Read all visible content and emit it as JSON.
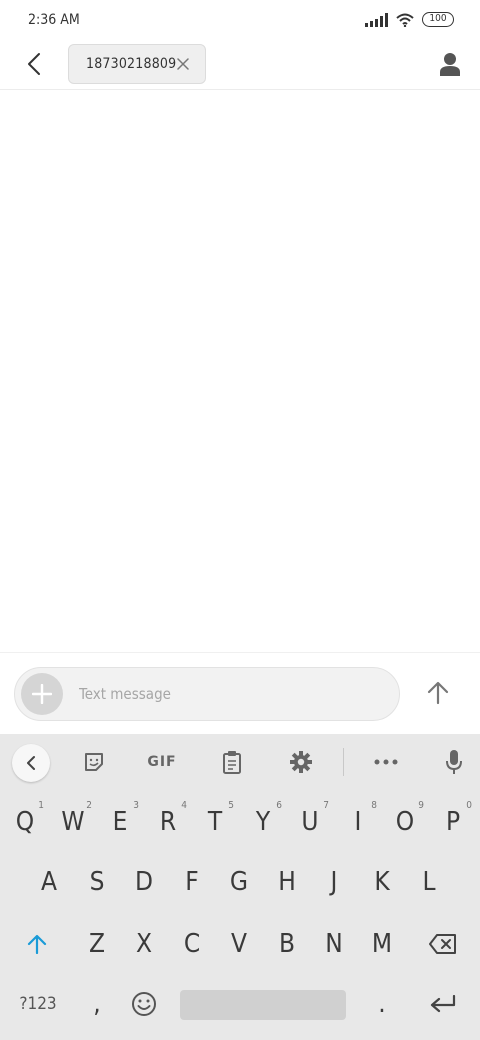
{
  "status_bar": {
    "time": "2:36 AM",
    "battery": "100",
    "icons": [
      "signal-icon",
      "wifi-icon",
      "battery-icon"
    ]
  },
  "header": {
    "back_icon": "chevron-left-icon",
    "recipient": "18730218809",
    "chip_close_icon": "close-icon",
    "contact_icon": "person-icon"
  },
  "compose": {
    "attach_icon": "plus-icon",
    "placeholder": "Text message",
    "value": "",
    "send_icon": "arrow-up-icon"
  },
  "keyboard": {
    "toolbar": [
      "chevron-left-icon",
      "sticker-icon",
      "GIF",
      "clipboard-icon",
      "gear-icon",
      "more-icon",
      "mic-icon"
    ],
    "gif_label": "GIF",
    "row1": [
      {
        "label": "Q",
        "hint": "1"
      },
      {
        "label": "W",
        "hint": "2"
      },
      {
        "label": "E",
        "hint": "3"
      },
      {
        "label": "R",
        "hint": "4"
      },
      {
        "label": "T",
        "hint": "5"
      },
      {
        "label": "Y",
        "hint": "6"
      },
      {
        "label": "U",
        "hint": "7"
      },
      {
        "label": "I",
        "hint": "8"
      },
      {
        "label": "O",
        "hint": "9"
      },
      {
        "label": "P",
        "hint": "0"
      }
    ],
    "row2": [
      "A",
      "S",
      "D",
      "F",
      "G",
      "H",
      "J",
      "K",
      "L"
    ],
    "row3": [
      "Z",
      "X",
      "C",
      "V",
      "B",
      "N",
      "M"
    ],
    "row4": {
      "symbols": "?123",
      "comma": ",",
      "period": ".",
      "enter_icon": "enter-icon",
      "emoji_icon": "emoji-icon"
    },
    "shift_icon": "shift-icon",
    "backspace_icon": "backspace-icon"
  },
  "colors": {
    "accent": "#1a9bd7",
    "keyboard_bg": "#e8e8e8",
    "chip_bg": "#efefef"
  }
}
